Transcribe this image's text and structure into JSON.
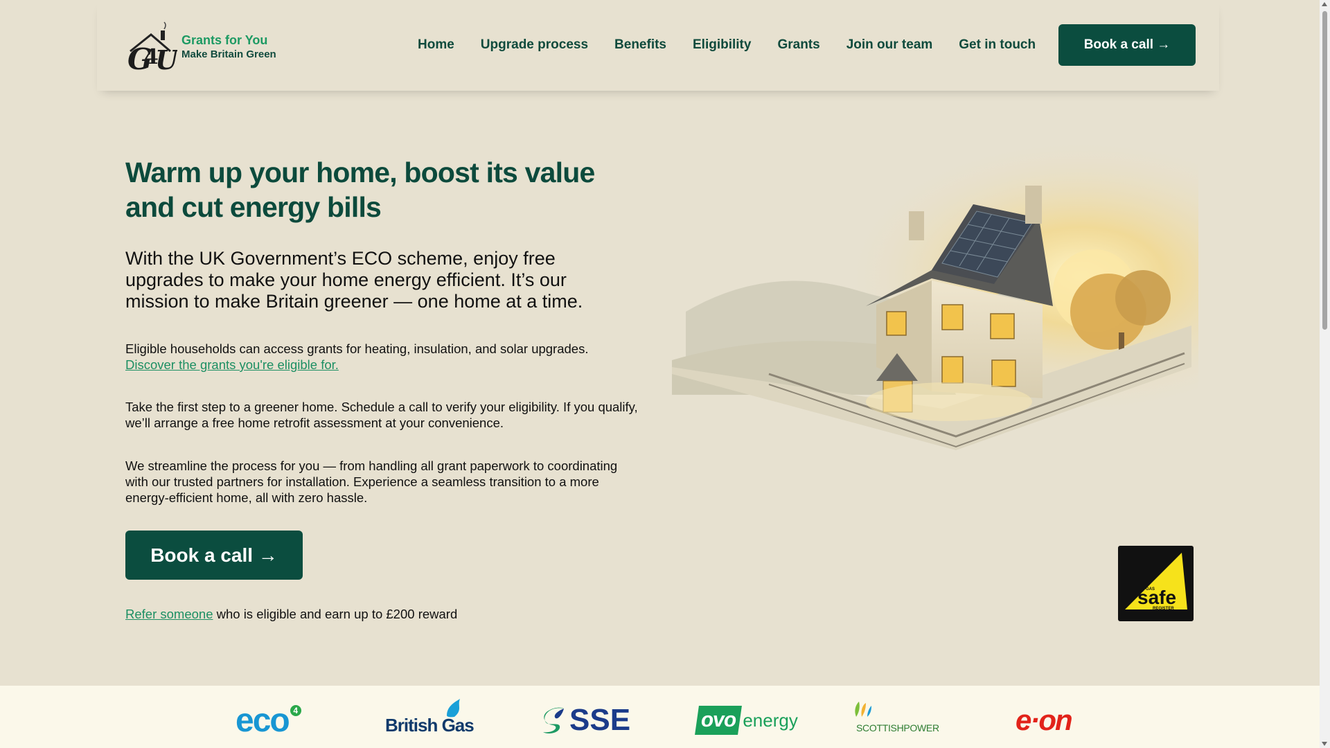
{
  "brand": {
    "title": "Grants for You",
    "tagline": "Make Britain Green",
    "accent": "#1d9a63",
    "dark": "#0b4d3f"
  },
  "nav": {
    "items": [
      "Home",
      "Upgrade process",
      "Benefits",
      "Eligibility",
      "Grants",
      "Join our team",
      "Get in touch"
    ],
    "cta": "Book a call →"
  },
  "hero": {
    "title": "Warm up your home, boost its value and cut energy bills",
    "lead": "With the UK Government’s ECO scheme, enjoy free upgrades to make your home energy efficient. It’s our mission to make Britain greener — one home at a time.",
    "p1_text": "Eligible households can access grants for heating, insulation, and solar upgrades.",
    "p1_link": "Discover the grants you're eligible for.",
    "p2": "Take the first step to a greener home. Schedule a call to verify your eligibility. If you qualify, we’ll arrange a free home retrofit assessment at your convenience.",
    "p3": "We streamline the process for you — from handling all grant paperwork to coordinating with our trusted partners for installation. Experience a seamless transition to a more energy-efficient home, all with zero hassle.",
    "cta": "Book a call →",
    "refer_link": "Refer someone",
    "refer_text": " who is eligible and earn up to £200 reward"
  },
  "badge": {
    "small_top": "GAS",
    "word": "safe",
    "small_bottom": "REGISTER"
  },
  "partners": {
    "eco": "eco",
    "eco_sup": "4",
    "british_gas": "British Gas",
    "sse": "SSE",
    "ovo_mark": "ovo",
    "ovo_word": "energy",
    "scottish": "SCOTTISHPOWER",
    "eon": "e·on"
  }
}
